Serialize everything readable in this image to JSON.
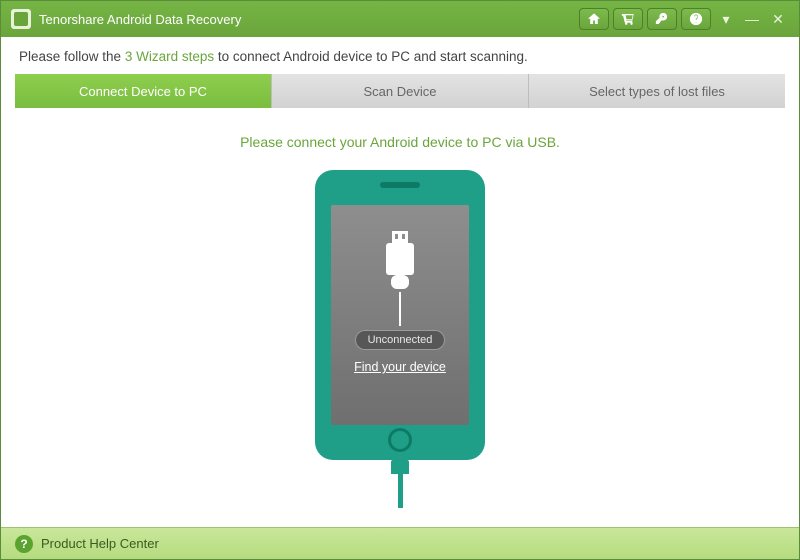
{
  "window": {
    "title": "Tenorshare Android Data Recovery"
  },
  "titlebar_buttons": {
    "home": "home-icon",
    "cart": "cart-icon",
    "key": "key-icon",
    "help": "help-icon"
  },
  "instruction": {
    "prefix": "Please follow the ",
    "highlight": "3 Wizard steps",
    "suffix": " to connect Android device to PC and start scanning."
  },
  "tabs": [
    {
      "label": "Connect Device to PC",
      "active": true
    },
    {
      "label": "Scan Device",
      "active": false
    },
    {
      "label": "Select types of lost files",
      "active": false
    }
  ],
  "main": {
    "prompt": "Please connect your Android device to PC via USB.",
    "status": "Unconnected",
    "find_link": "Find your device"
  },
  "footer": {
    "help_center": "Product Help Center"
  },
  "colors": {
    "brand_green": "#6aa53c",
    "teal": "#1f9f87"
  }
}
